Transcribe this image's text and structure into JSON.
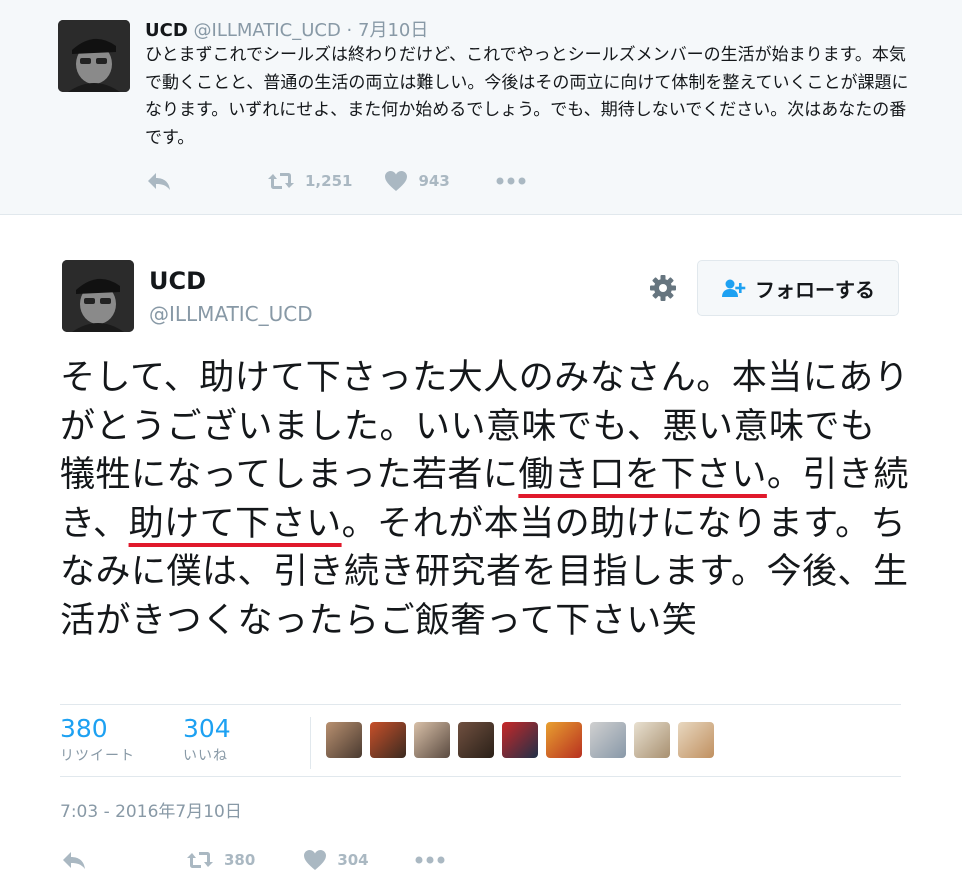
{
  "previous_tweet": {
    "name": "UCD",
    "handle": "@ILLMATIC_UCD",
    "separator": "·",
    "date": "7月10日",
    "text": "ひとまずこれでシールズは終わりだけど、これでやっとシールズメンバーの生活が始まります。本気で動くことと、普通の生活の両立は難しい。今後はその両立に向けて体制を整えていくことが課題になります。いずれにせよ、また何か始めるでしょう。でも、期待しないでください。次はあなたの番です。",
    "retweets": "1,251",
    "likes": "943"
  },
  "main_tweet": {
    "name": "UCD",
    "handle": "@ILLMATIC_UCD",
    "follow_label": "フォローする",
    "text_parts": {
      "p1": "そして、助けて下さった大人のみなさん。本当にありがとうございました。いい意味でも、悪い意味でも犠牲になってしまった若者に",
      "p2": "働き口を下さい",
      "p3": "。引き続き、",
      "p4": "助けて下さい",
      "p5": "。それが本当の助けになります。ちなみに僕は、引き続き研究者を目指します。今後、生活がきつくなったらご飯奢って下さい笑"
    },
    "retweet_count": "380",
    "retweet_label": "リツイート",
    "like_count": "304",
    "like_label": "いいね",
    "timestamp": "7:03 - 2016年7月10日",
    "action_retweets": "380",
    "action_likes": "304",
    "highlight_color": "#e0192b"
  },
  "likers": [
    "avatar-1",
    "avatar-2",
    "avatar-3",
    "avatar-4",
    "avatar-5",
    "avatar-6",
    "avatar-7",
    "avatar-8",
    "avatar-9"
  ],
  "icons": [
    "reply-icon",
    "retweet-icon",
    "heart-icon",
    "more-icon",
    "gear-icon",
    "follow-person-icon"
  ],
  "colors": {
    "accent": "#1da1f2",
    "muted": "#8899a6",
    "icon": "#aab8c2",
    "background_prev": "#f5f8fa"
  }
}
